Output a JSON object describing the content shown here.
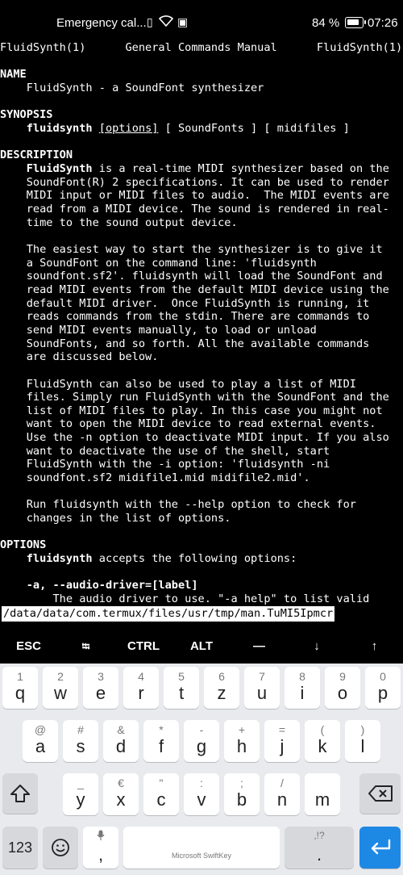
{
  "status": {
    "carrier": "Emergency cal...",
    "battery": "84 %",
    "battery_level": 0.84,
    "time": "07:26"
  },
  "terminal": {
    "lines": [
      "FluidSynth(1)      General Commands Manual      FluidSynth(1)",
      "",
      "NAME",
      "    FluidSynth - a SoundFont synthesizer",
      "",
      "SYNOPSIS",
      "",
      "",
      "DESCRIPTION",
      "",
      "    SoundFont(R) 2 specifications. It can be used to render",
      "    MIDI input or MIDI files to audio.  The MIDI events are",
      "    read from a MIDI device. The sound is rendered in real-",
      "    time to the sound output device.",
      "",
      "    The easiest way to start the synthesizer is to give it",
      "    a SoundFont on the command line: 'fluidsynth",
      "    soundfont.sf2'. fluidsynth will load the SoundFont and",
      "    read MIDI events from the default MIDI device using the",
      "    default MIDI driver.  Once FluidSynth is running, it",
      "    reads commands from the stdin. There are commands to",
      "    send MIDI events manually, to load or unload",
      "    SoundFonts, and so forth. All the available commands",
      "    are discussed below.",
      "",
      "    FluidSynth can also be used to play a list of MIDI",
      "    files. Simply run FluidSynth with the SoundFont and the",
      "    list of MIDI files to play. In this case you might not",
      "    want to open the MIDI device to read external events.",
      "    Use the -n option to deactivate MIDI input. If you also",
      "    want to deactivate the use of the shell, start",
      "    FluidSynth with the -i option: 'fluidsynth -ni",
      "    soundfont.sf2 midifile1.mid midifile2.mid'.",
      "",
      "    Run fluidsynth with the --help option to check for",
      "    changes in the list of options.",
      "",
      "OPTIONS",
      "",
      "",
      "",
      "        The audio driver to use. \"-a help\" to list valid"
    ],
    "synopsis": {
      "indent": "    ",
      "cmd": "fluidsynth",
      "sp1": " ",
      "opt": "[options]",
      "rest": " [ SoundFonts ] [ midifiles ]"
    },
    "desc_first": {
      "indent": "    ",
      "cmd": "FluidSynth",
      "rest": " is a real-time MIDI synthesizer based on the"
    },
    "options_first": {
      "indent": "    ",
      "cmd": "fluidsynth",
      "rest": " accepts the following options:"
    },
    "option_a": "    -a, --audio-driver=[label]",
    "command_line": "/data/data/com.termux/files/usr/tmp/man.TuMI5Ipmcr"
  },
  "extra_keys": [
    "ESC",
    "⭾",
    "CTRL",
    "ALT",
    "—",
    "↓",
    "↑"
  ],
  "keyboard": {
    "row1": [
      {
        "hint": "1",
        "key": "q"
      },
      {
        "hint": "2",
        "key": "w"
      },
      {
        "hint": "3",
        "key": "e"
      },
      {
        "hint": "4",
        "key": "r"
      },
      {
        "hint": "5",
        "key": "t"
      },
      {
        "hint": "6",
        "key": "z"
      },
      {
        "hint": "7",
        "key": "u"
      },
      {
        "hint": "8",
        "key": "i"
      },
      {
        "hint": "9",
        "key": "o"
      },
      {
        "hint": "0",
        "key": "p"
      }
    ],
    "row2": [
      {
        "hint": "@",
        "key": "a"
      },
      {
        "hint": "#",
        "key": "s"
      },
      {
        "hint": "&",
        "key": "d"
      },
      {
        "hint": "*",
        "key": "f"
      },
      {
        "hint": "-",
        "key": "g"
      },
      {
        "hint": "+",
        "key": "h"
      },
      {
        "hint": "=",
        "key": "j"
      },
      {
        "hint": "(",
        "key": "k"
      },
      {
        "hint": ")",
        "key": "l"
      }
    ],
    "row3": [
      {
        "hint": "_",
        "key": "y"
      },
      {
        "hint": "€",
        "key": "x"
      },
      {
        "hint": "\"",
        "key": "c"
      },
      {
        "hint": ":",
        "key": "v"
      },
      {
        "hint": ";",
        "key": "b"
      },
      {
        "hint": "/",
        "key": "n"
      },
      {
        "hint": "",
        "key": "m"
      }
    ],
    "numbers_label": "123",
    "comma": ",",
    "space_brand": "Microsoft SwiftKey",
    "period": ".",
    "period_hint": ",!?"
  }
}
